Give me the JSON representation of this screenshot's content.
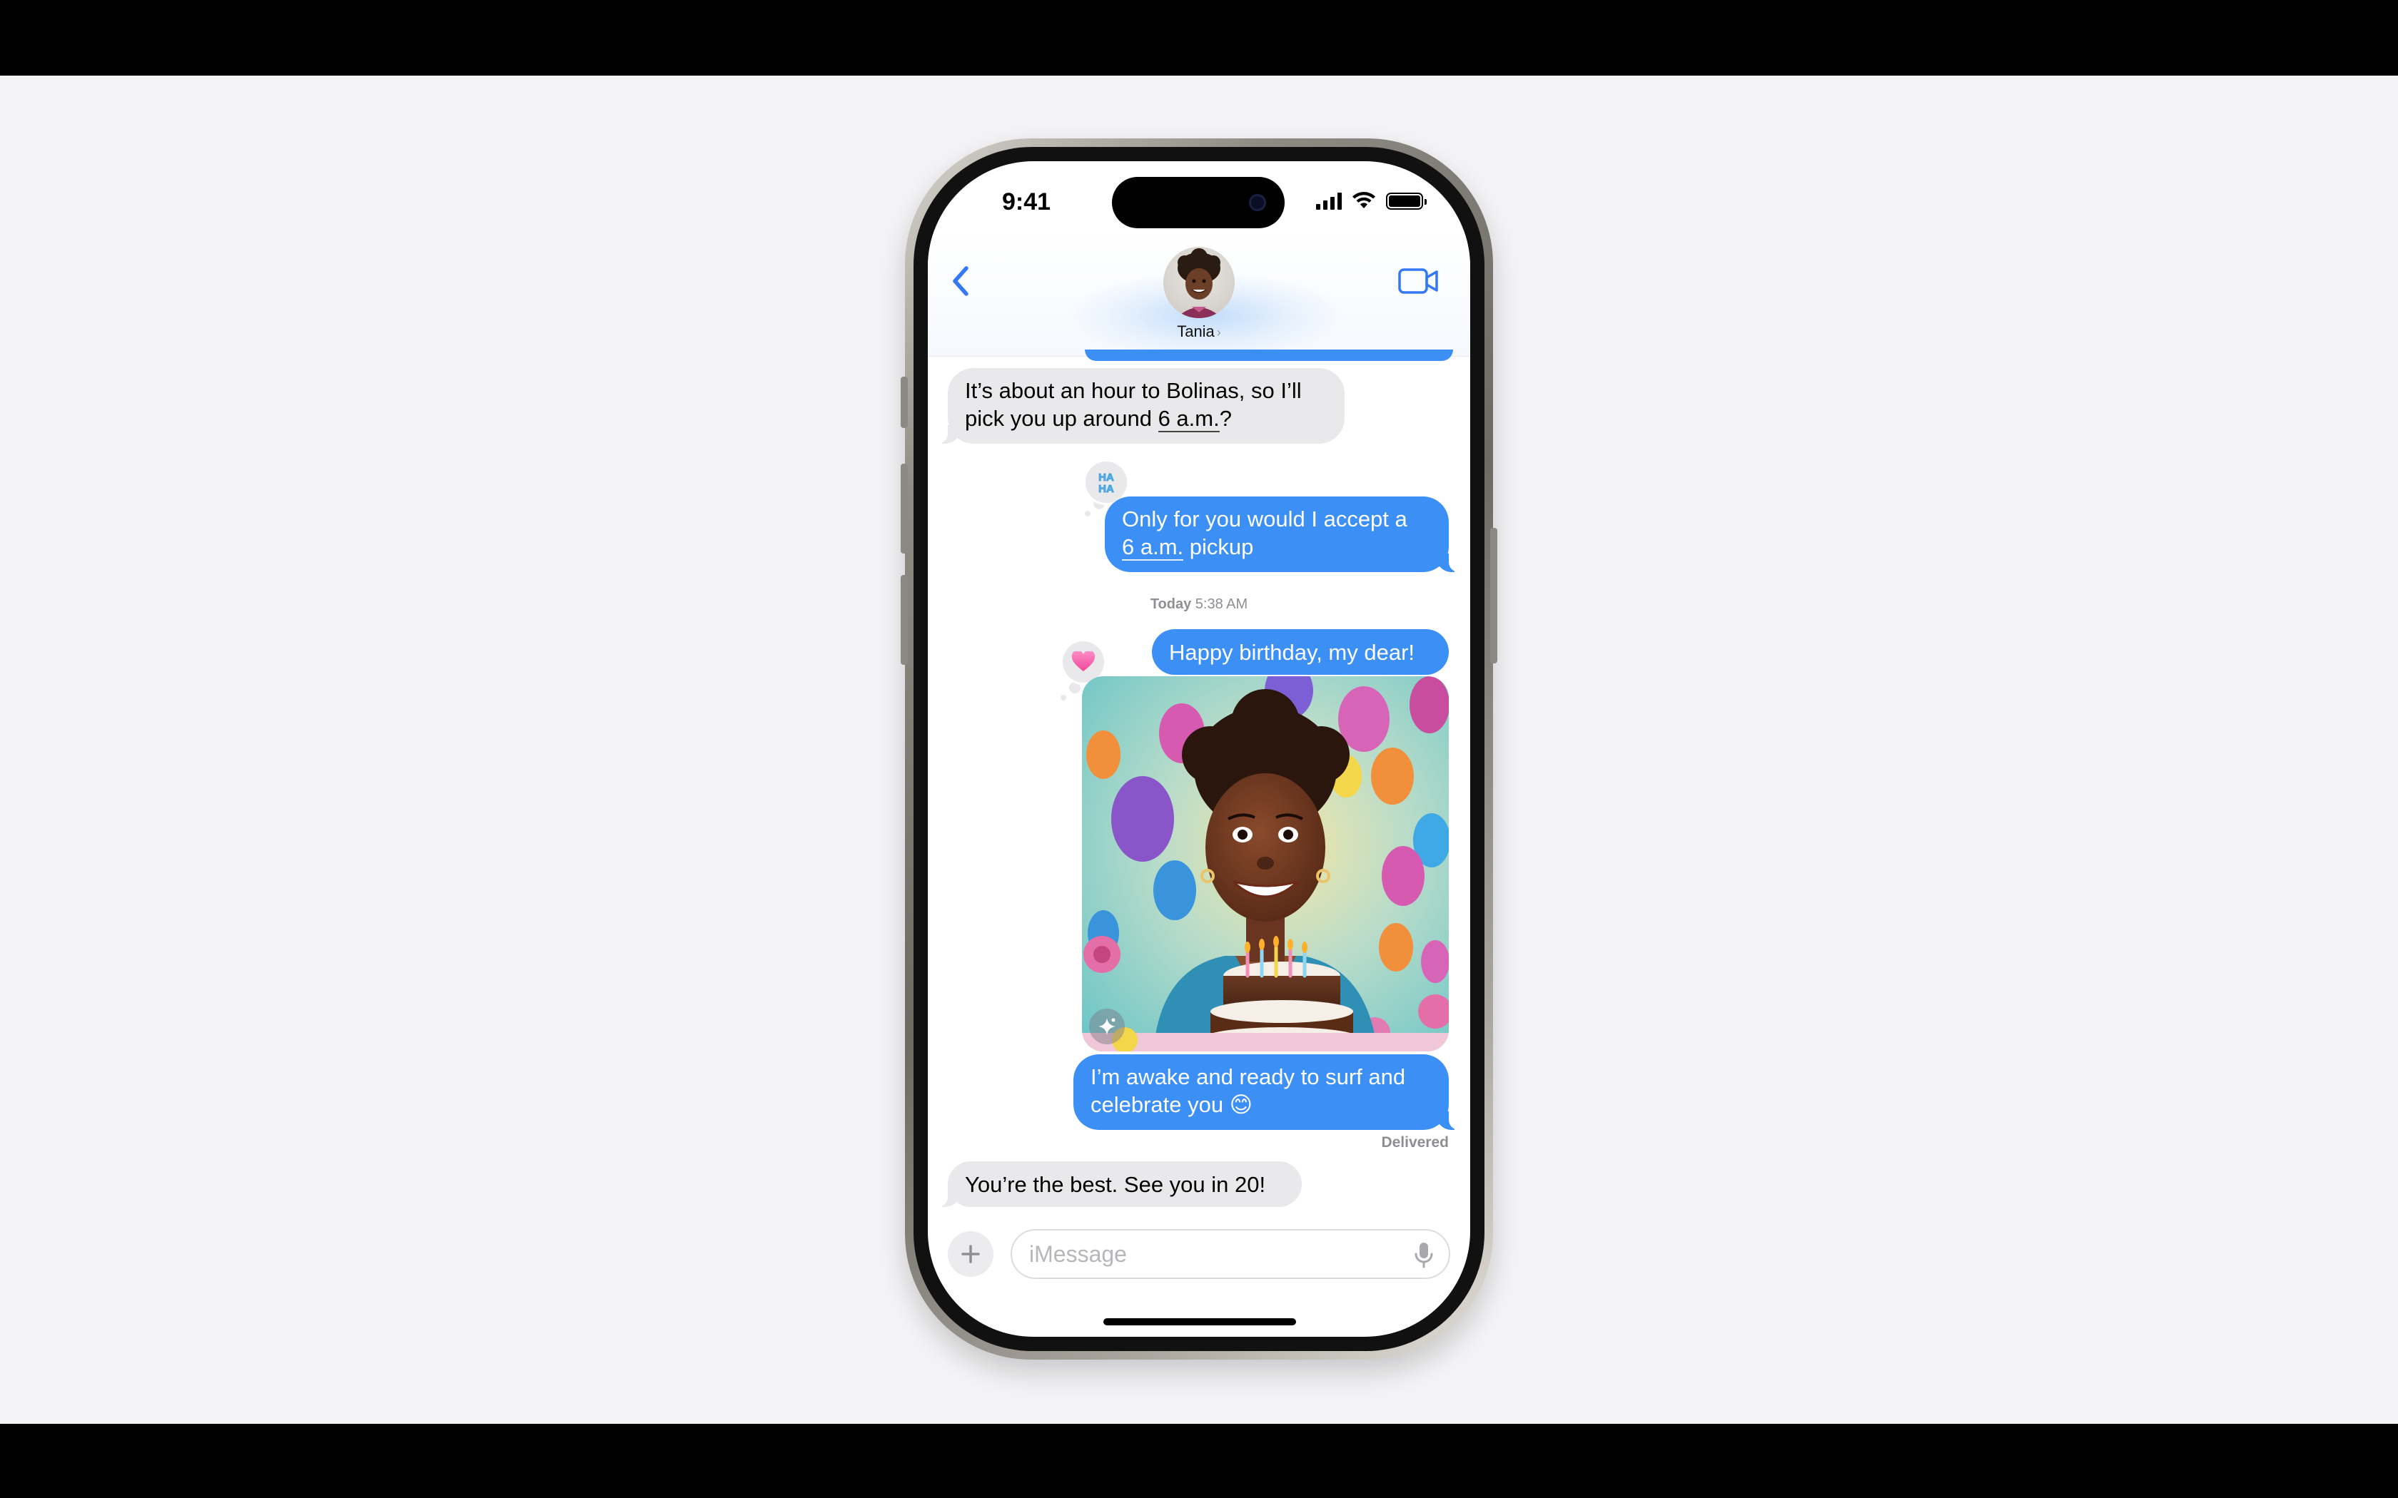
{
  "status_bar": {
    "time": "9:41"
  },
  "header": {
    "contact_name": "Tania",
    "contact_chevron": "›"
  },
  "messages": [
    {
      "direction": "incoming",
      "line1": "It’s about an hour to Bolinas, so I’ll",
      "line2_pre": "pick you up around ",
      "line2_link": "6 a.m.",
      "line2_post": "?"
    },
    {
      "direction": "outgoing",
      "line1": "Only for you would I accept a",
      "line2_link": "6 a.m.",
      "line2_post": " pickup",
      "tapback_icon": "haha-icon"
    },
    {
      "direction": "outgoing",
      "text": "Happy birthday, my dear!",
      "tapback_icon": "heart-icon"
    },
    {
      "direction": "outgoing",
      "type": "image",
      "image_icon": "sparkle-icon"
    },
    {
      "direction": "outgoing",
      "line1": "I’m awake and ready to surf and",
      "line2": "celebrate you 😊"
    },
    {
      "direction": "incoming",
      "text": "You’re the best. See you in 20!"
    }
  ],
  "timestamp": {
    "day": "Today",
    "time": "5:38 AM"
  },
  "delivery_status": "Delivered",
  "composer": {
    "placeholder": "iMessage"
  },
  "colors": {
    "outgoing_bubble": "#3b8ff5",
    "incoming_bubble": "#e9e9eb",
    "accent": "#3478f6"
  }
}
